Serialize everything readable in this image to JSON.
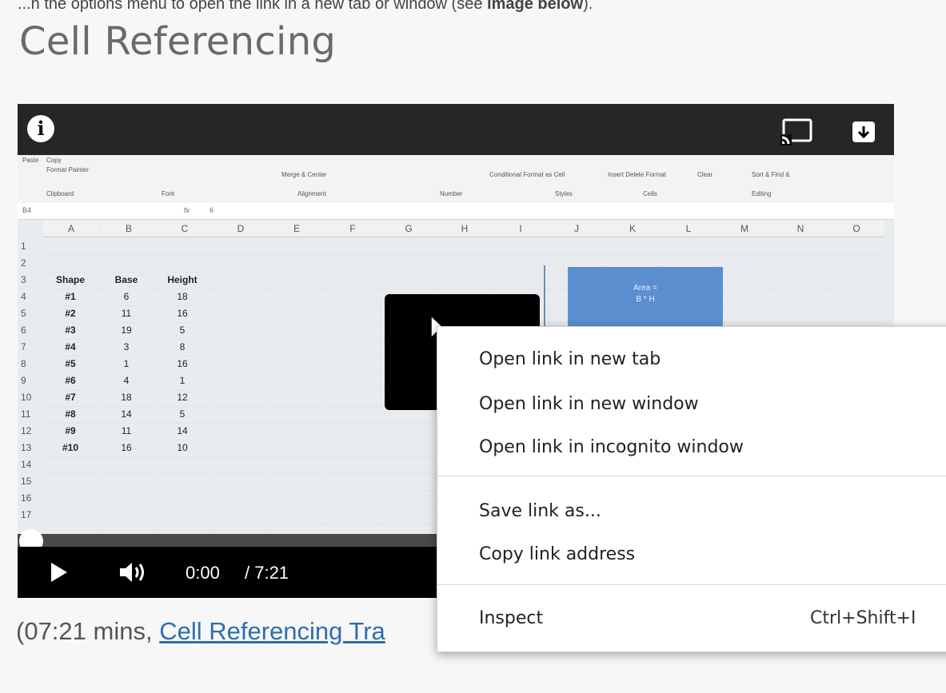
{
  "top_text": {
    "before": "...n the options menu to open the link in a new tab or window (see ",
    "bold": "image below",
    "after": ")."
  },
  "page": {
    "title": "Cell Referencing"
  },
  "video": {
    "time": "0:00",
    "duration": "/ 7:21",
    "progress": 0,
    "buttons": {
      "info": "i"
    },
    "area_box": {
      "line1": "Area =",
      "line2": "B * H"
    },
    "formula_bar": {
      "cell_ref": "B4",
      "fx": "fx",
      "value": "6"
    },
    "ribbon": {
      "copy": "Copy",
      "format_painter": "Format Painter",
      "paste": "Paste",
      "clipboard": "Clipboard",
      "font": "Font",
      "alignment": "Alignment",
      "number": "Number",
      "styles": "Styles",
      "cells": "Cells",
      "editing": "Editing",
      "merge_center": "Merge & Center",
      "conditional": "Conditional Format as Cell",
      "insert": "Insert Delete Format",
      "clear": "Clear",
      "sort": "Sort & Find &"
    },
    "spreadsheet": {
      "columns": [
        "A",
        "B",
        "C",
        "D",
        "E",
        "F",
        "G",
        "H",
        "I",
        "J",
        "K",
        "L",
        "M",
        "N",
        "O"
      ],
      "row_numbers": [
        "1",
        "2",
        "3",
        "4",
        "5",
        "6",
        "7",
        "8",
        "9",
        "10",
        "11",
        "12",
        "13",
        "14",
        "15",
        "16",
        "17"
      ],
      "headers": [
        "Shape",
        "Base",
        "Height"
      ],
      "rows": [
        [
          "#1",
          "6",
          "18"
        ],
        [
          "#2",
          "11",
          "16"
        ],
        [
          "#3",
          "19",
          "5"
        ],
        [
          "#4",
          "3",
          "8"
        ],
        [
          "#5",
          "1",
          "16"
        ],
        [
          "#6",
          "4",
          "1"
        ],
        [
          "#7",
          "18",
          "12"
        ],
        [
          "#8",
          "14",
          "5"
        ],
        [
          "#9",
          "11",
          "14"
        ],
        [
          "#10",
          "16",
          "10"
        ]
      ]
    }
  },
  "caption": {
    "prefix": "(07:21 mins, ",
    "link": "Cell Referencing Tra"
  },
  "context_menu": {
    "items": [
      {
        "label": "Open link in new tab"
      },
      {
        "label": "Open link in new window"
      },
      {
        "label": "Open link in incognito window"
      },
      {
        "label": "Save link as..."
      },
      {
        "label": "Copy link address"
      },
      {
        "label": "Inspect",
        "shortcut": "Ctrl+Shift+I"
      }
    ]
  },
  "colors": {
    "link": "#2a6fb0",
    "title": "#6a6a6a",
    "area_box": "#5b8fd0"
  }
}
